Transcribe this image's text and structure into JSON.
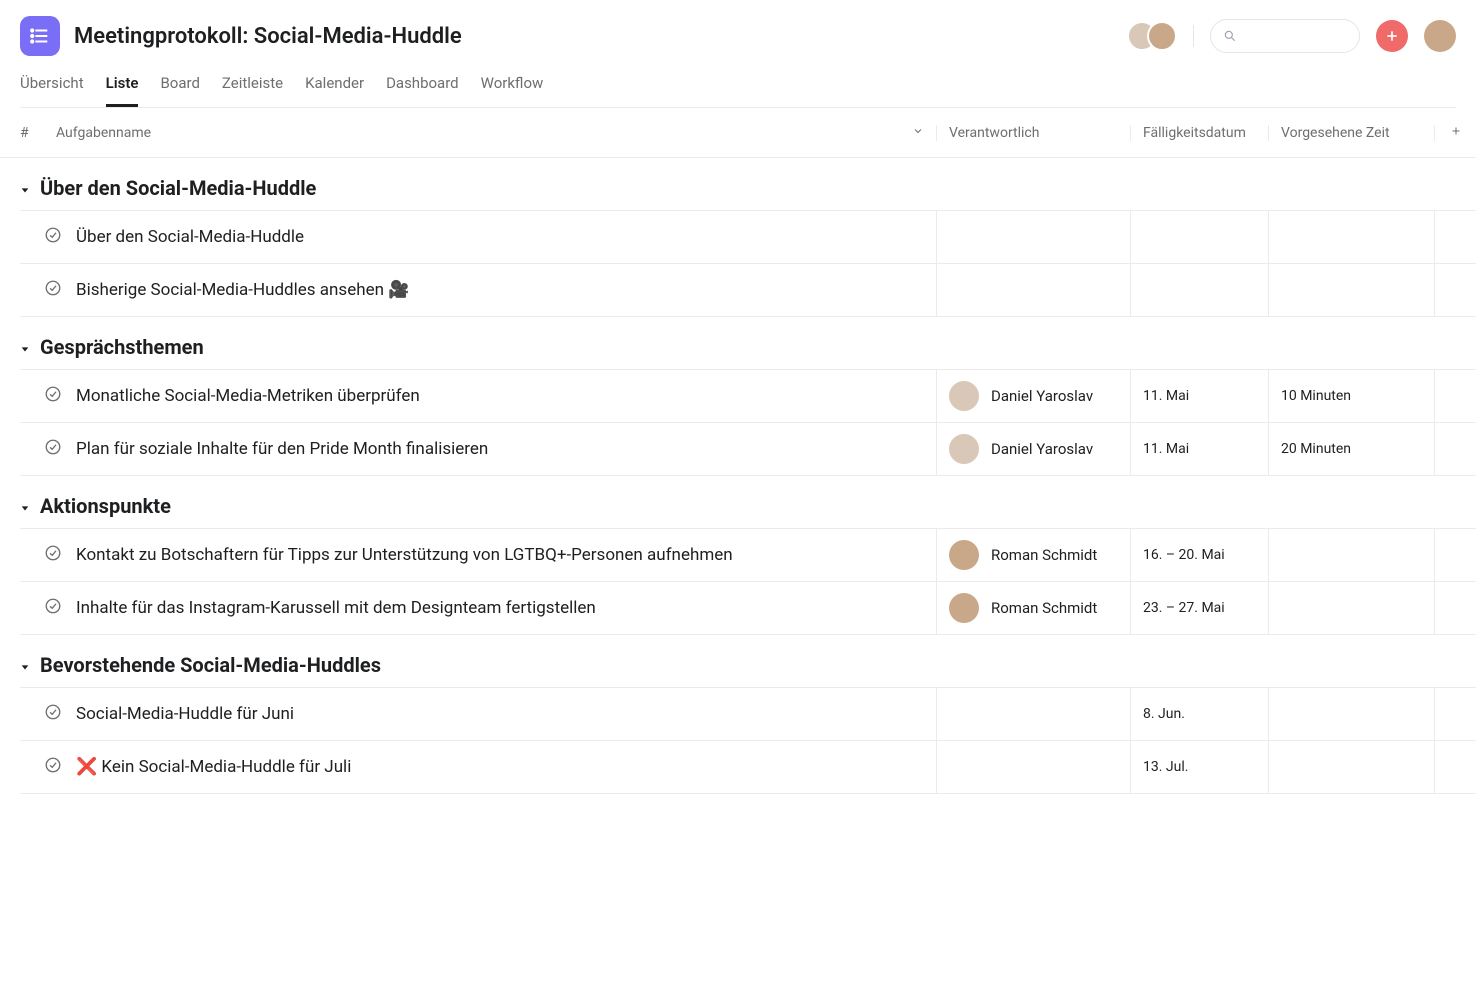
{
  "header": {
    "title": "Meetingprotokoll: Social-Media-Huddle"
  },
  "tabs": [
    {
      "label": "Übersicht",
      "active": false
    },
    {
      "label": "Liste",
      "active": true
    },
    {
      "label": "Board",
      "active": false
    },
    {
      "label": "Zeitleiste",
      "active": false
    },
    {
      "label": "Kalender",
      "active": false
    },
    {
      "label": "Dashboard",
      "active": false
    },
    {
      "label": "Workflow",
      "active": false
    }
  ],
  "columns": {
    "num": "#",
    "task": "Aufgabenname",
    "assignee": "Verantwortlich",
    "due": "Fälligkeitsdatum",
    "time": "Vorgesehene Zeit"
  },
  "sections": [
    {
      "title": "Über den Social-Media-Huddle",
      "rows": [
        {
          "task": "Über den Social-Media-Huddle",
          "assignee": "",
          "due": "",
          "time": ""
        },
        {
          "task": "Bisherige Social-Media-Huddles ansehen 🎥",
          "assignee": "",
          "due": "",
          "time": ""
        }
      ]
    },
    {
      "title": "Gesprächsthemen",
      "rows": [
        {
          "task": "Monatliche Social-Media-Metriken überprüfen",
          "assignee": "Daniel Yaroslav",
          "avatar": "daniel",
          "due": "11. Mai",
          "time": "10 Minuten"
        },
        {
          "task": "Plan für soziale Inhalte für den Pride Month finalisieren",
          "assignee": "Daniel Yaroslav",
          "avatar": "daniel",
          "due": "11. Mai",
          "time": "20 Minuten"
        }
      ]
    },
    {
      "title": "Aktionspunkte",
      "rows": [
        {
          "task": "Kontakt zu Botschaftern für Tipps zur Unterstützung von LGTBQ+-Personen aufnehmen",
          "assignee": "Roman Schmidt",
          "avatar": "roman",
          "due": "16. – 20. Mai",
          "time": ""
        },
        {
          "task": "Inhalte für das Instagram-Karussell mit dem Designteam fertigstellen",
          "assignee": "Roman Schmidt",
          "avatar": "roman",
          "due": "23. – 27. Mai",
          "time": ""
        }
      ]
    },
    {
      "title": "Bevorstehende Social-Media-Huddles",
      "rows": [
        {
          "task": "Social-Media-Huddle für Juni",
          "assignee": "",
          "due": "8. Jun.",
          "time": ""
        },
        {
          "task": "❌ Kein Social-Media-Huddle für Juli",
          "assignee": "",
          "due": "13. Jul.",
          "time": ""
        }
      ]
    }
  ],
  "avatar_colors": {
    "daniel": "#d9c7b8",
    "roman": "#c9a88a",
    "user": "#b8c5d6"
  }
}
